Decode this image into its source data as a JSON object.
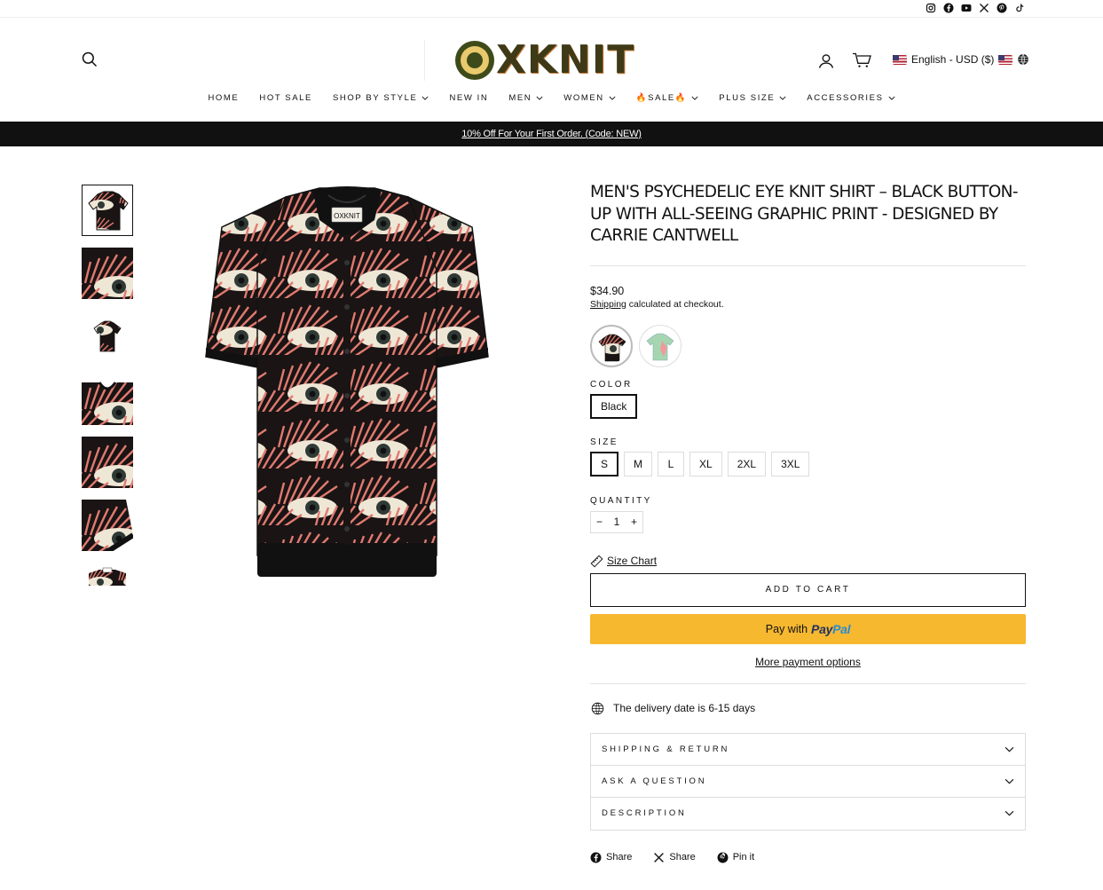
{
  "socials": [
    "instagram-icon",
    "facebook-icon",
    "youtube-icon",
    "x-icon",
    "pinterest-icon",
    "tiktok-icon"
  ],
  "header": {
    "logo_text": "XKNIT",
    "language": "English - USD ($)"
  },
  "nav": [
    {
      "label": "HOME",
      "dropdown": false
    },
    {
      "label": "HOT SALE",
      "dropdown": false
    },
    {
      "label": "SHOP BY STYLE",
      "dropdown": true
    },
    {
      "label": "NEW IN",
      "dropdown": false
    },
    {
      "label": "MEN",
      "dropdown": true
    },
    {
      "label": "WOMEN",
      "dropdown": true
    },
    {
      "label": "🔥SALE🔥",
      "dropdown": true
    },
    {
      "label": "PLUS SIZE",
      "dropdown": true
    },
    {
      "label": "ACCESSORIES",
      "dropdown": true
    }
  ],
  "promo": "10% Off For Your First Order. (Code: NEW)",
  "product": {
    "title": "MEN'S PSYCHEDELIC EYE KNIT SHIRT – BLACK BUTTON-UP WITH ALL-SEEING GRAPHIC PRINT - DESIGNED BY CARRIE CANTWELL",
    "price": "$34.90",
    "shipping_link": "Shipping",
    "shipping_rest": " calculated at checkout.",
    "color_label": "COLOR",
    "color_value": "Black",
    "size_label": "SIZE",
    "sizes": [
      "S",
      "M",
      "L",
      "XL",
      "2XL",
      "3XL"
    ],
    "selected_size": "S",
    "quantity_label": "QUANTITY",
    "quantity": "1",
    "qty_minus": "−",
    "qty_plus": "+",
    "size_chart": "Size Chart",
    "add_to_cart": "ADD TO CART",
    "paypal_prefix": "Pay with",
    "paypal_brand_1": "Pay",
    "paypal_brand_2": "Pal",
    "more_payment": "More payment options",
    "delivery": "The delivery date is 6-15 days"
  },
  "accordion": [
    "SHIPPING & RETURN",
    "ASK A QUESTION",
    "DESCRIPTION"
  ],
  "share": [
    "Share",
    "Share",
    "Pin it"
  ],
  "colors": {
    "accent": "#111111",
    "paypal_yellow": "#f5b82f",
    "shirt_black": "#1a1414",
    "shirt_coral": "#e07a70",
    "shirt_cream": "#efe7d6"
  }
}
